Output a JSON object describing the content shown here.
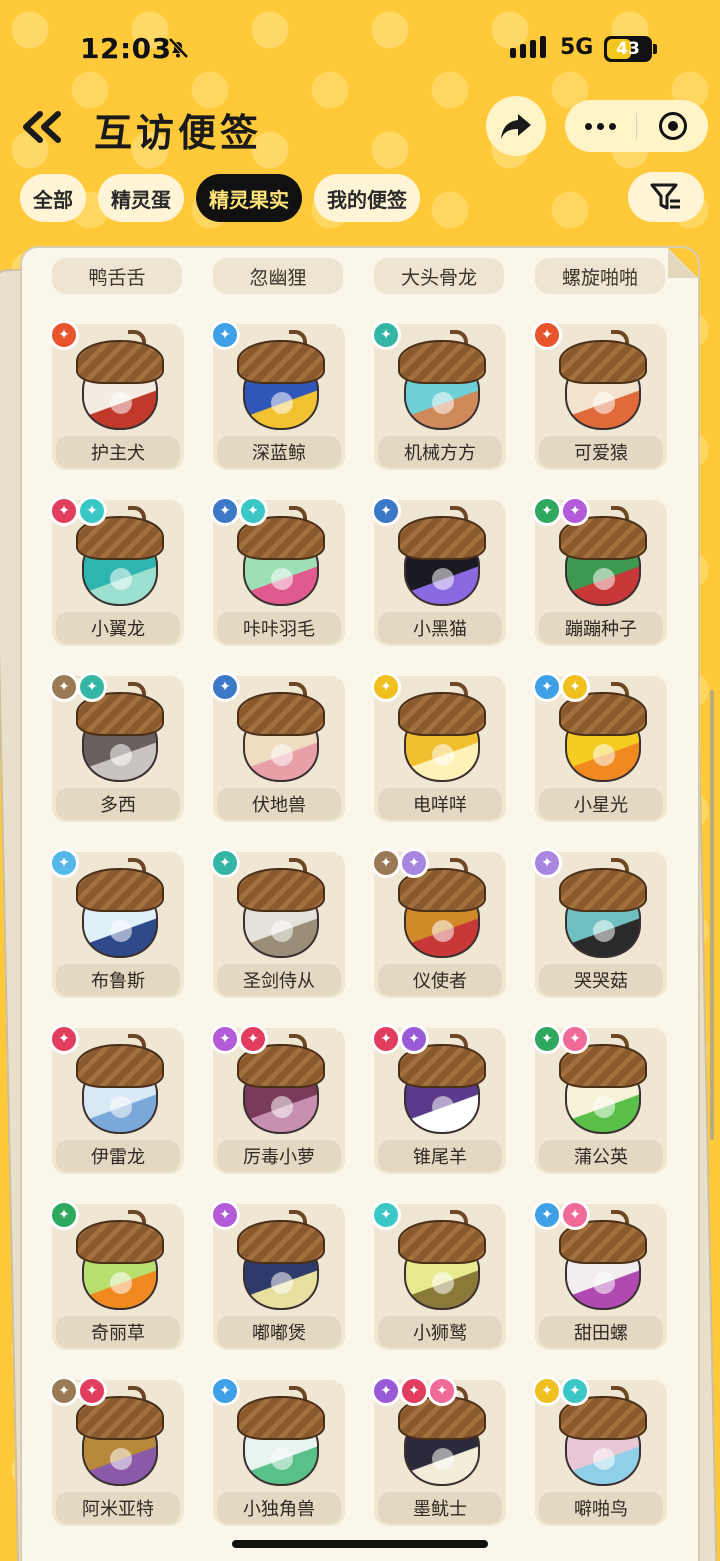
{
  "status_bar": {
    "time": "12:03",
    "network": "5G",
    "battery": "43"
  },
  "header": {
    "title": "互访便签"
  },
  "tabs": [
    {
      "label": "全部",
      "active": false
    },
    {
      "label": "精灵蛋",
      "active": false
    },
    {
      "label": "精灵果实",
      "active": true
    },
    {
      "label": "我的便签",
      "active": false
    }
  ],
  "top_partial_row": [
    "鸭舌舌",
    "忽幽狸",
    "大头骨龙",
    "螺旋啪啪"
  ],
  "items": [
    {
      "name": "护主犬",
      "badges": [
        "#e8542c"
      ],
      "nut": "#f4ece0",
      "band": "#c0392b"
    },
    {
      "name": "深蓝鲸",
      "badges": [
        "#3fa0e8"
      ],
      "nut": "#2f56b8",
      "band": "#f2c233"
    },
    {
      "name": "机械方方",
      "badges": [
        "#35b5a4"
      ],
      "nut": "#6fd0d8",
      "band": "#d08a5a"
    },
    {
      "name": "可爱猿",
      "badges": [
        "#e8542c"
      ],
      "nut": "#f3e3cc",
      "band": "#e06a3a"
    },
    {
      "name": "小翼龙",
      "badges": [
        "#e23d5e",
        "#3cc7c7"
      ],
      "nut": "#2fb5b0",
      "band": "#9be0d0"
    },
    {
      "name": "咔咔羽毛",
      "badges": [
        "#3c78c8",
        "#3cc7c7"
      ],
      "nut": "#9ee0b5",
      "band": "#e05a90"
    },
    {
      "name": "小黑猫",
      "badges": [
        "#3c78c8"
      ],
      "nut": "#1a1a22",
      "band": "#8a6ae0"
    },
    {
      "name": "蹦蹦种子",
      "badges": [
        "#2fa860",
        "#b25ad8"
      ],
      "nut": "#3e9a50",
      "band": "#c83838"
    },
    {
      "name": "多西",
      "badges": [
        "#9a7a55",
        "#35b5a4"
      ],
      "nut": "#6a6060",
      "band": "#c9c4bf"
    },
    {
      "name": "伏地兽",
      "badges": [
        "#3c78c8"
      ],
      "nut": "#f0dcc0",
      "band": "#e8a0a8"
    },
    {
      "name": "电咩咩",
      "badges": [
        "#f0c020"
      ],
      "nut": "#f0c030",
      "band": "#fff1b8"
    },
    {
      "name": "小星光",
      "badges": [
        "#3fa0e8",
        "#f0c020"
      ],
      "nut": "#f5cc22",
      "band": "#f08a20"
    },
    {
      "name": "布鲁斯",
      "badges": [
        "#55b8e8"
      ],
      "nut": "#dff0f8",
      "band": "#2e4a8a"
    },
    {
      "name": "圣剑侍从",
      "badges": [
        "#35b5a4"
      ],
      "nut": "#e6e2da",
      "band": "#9a8e78"
    },
    {
      "name": "仪使者",
      "badges": [
        "#9a7a55",
        "#a886e0"
      ],
      "nut": "#d08a2a",
      "band": "#c83838"
    },
    {
      "name": "哭哭菇",
      "badges": [
        "#a886e0"
      ],
      "nut": "#6fc0c0",
      "band": "#2a2a2a"
    },
    {
      "name": "伊雷龙",
      "badges": [
        "#e23d5e"
      ],
      "nut": "#d8e8f5",
      "band": "#7aa8d8"
    },
    {
      "name": "厉毒小萝",
      "badges": [
        "#b25ad8",
        "#e23d5e"
      ],
      "nut": "#7a3a5a",
      "band": "#c890b0"
    },
    {
      "name": "锥尾羊",
      "badges": [
        "#e23d5e",
        "#9a5ad8"
      ],
      "nut": "#5a3a8a",
      "band": "#ffffff"
    },
    {
      "name": "蒲公英",
      "badges": [
        "#2fa860",
        "#f06a9a"
      ],
      "nut": "#f6f2d8",
      "band": "#5ac04a"
    },
    {
      "name": "奇丽草",
      "badges": [
        "#2fa860"
      ],
      "nut": "#b8e070",
      "band": "#f08a20"
    },
    {
      "name": "嘟嘟煲",
      "badges": [
        "#b25ad8"
      ],
      "nut": "#2e3a6a",
      "band": "#e8e0a0"
    },
    {
      "name": "小狮鹫",
      "badges": [
        "#3cc7c7"
      ],
      "nut": "#e8ea90",
      "band": "#8a7a3a"
    },
    {
      "name": "甜田螺",
      "badges": [
        "#3fa0e8",
        "#f06a9a"
      ],
      "nut": "#f2eef0",
      "band": "#b04ab0"
    },
    {
      "name": "阿米亚特",
      "badges": [
        "#9a7a55",
        "#e23d5e"
      ],
      "nut": "#b8893a",
      "band": "#8a5aa8"
    },
    {
      "name": "小独角兽",
      "badges": [
        "#3fa0e8"
      ],
      "nut": "#e8f4f0",
      "band": "#5ac08a"
    },
    {
      "name": "墨鱿士",
      "badges": [
        "#9a5ad8",
        "#e23d5e",
        "#f06a9a"
      ],
      "nut": "#2a2a3a",
      "band": "#f2ecd8"
    },
    {
      "name": "噼啪鸟",
      "badges": [
        "#f0c020",
        "#3cc7c7"
      ],
      "nut": "#e8c8d8",
      "band": "#8fd0e8"
    }
  ]
}
